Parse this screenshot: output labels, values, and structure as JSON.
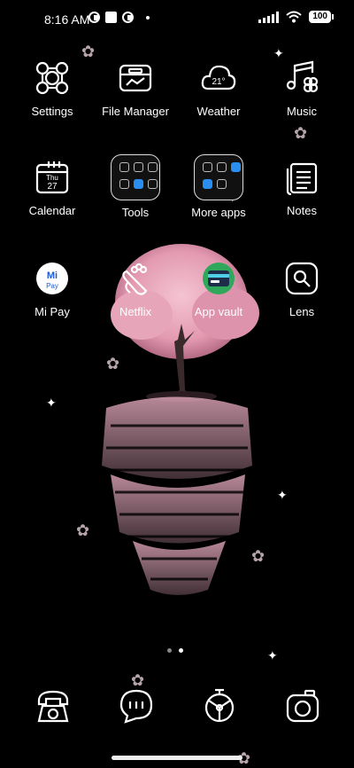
{
  "status_bar": {
    "time": "8:16 AM",
    "battery": "100"
  },
  "apps": [
    {
      "label": "Settings"
    },
    {
      "label": "File Manager"
    },
    {
      "label": "Weather",
      "temp": "21°"
    },
    {
      "label": "Music"
    },
    {
      "label": "Calendar",
      "day": "Thu",
      "date": "27"
    },
    {
      "label": "Tools"
    },
    {
      "label": "More apps"
    },
    {
      "label": "Notes"
    },
    {
      "label": "Mi Pay",
      "badge_top": "Mi",
      "badge_bottom": "Pay"
    },
    {
      "label": "Netflix"
    },
    {
      "label": "App vault"
    },
    {
      "label": "Lens"
    }
  ],
  "dock": [
    "phone-icon",
    "messages-icon",
    "browser-icon",
    "camera-icon"
  ],
  "page_indicator": {
    "pages": 2,
    "current": 2
  },
  "colors": {
    "background": "#000000",
    "tree": "#e8a3b8",
    "accent": "#2a8ef0"
  }
}
